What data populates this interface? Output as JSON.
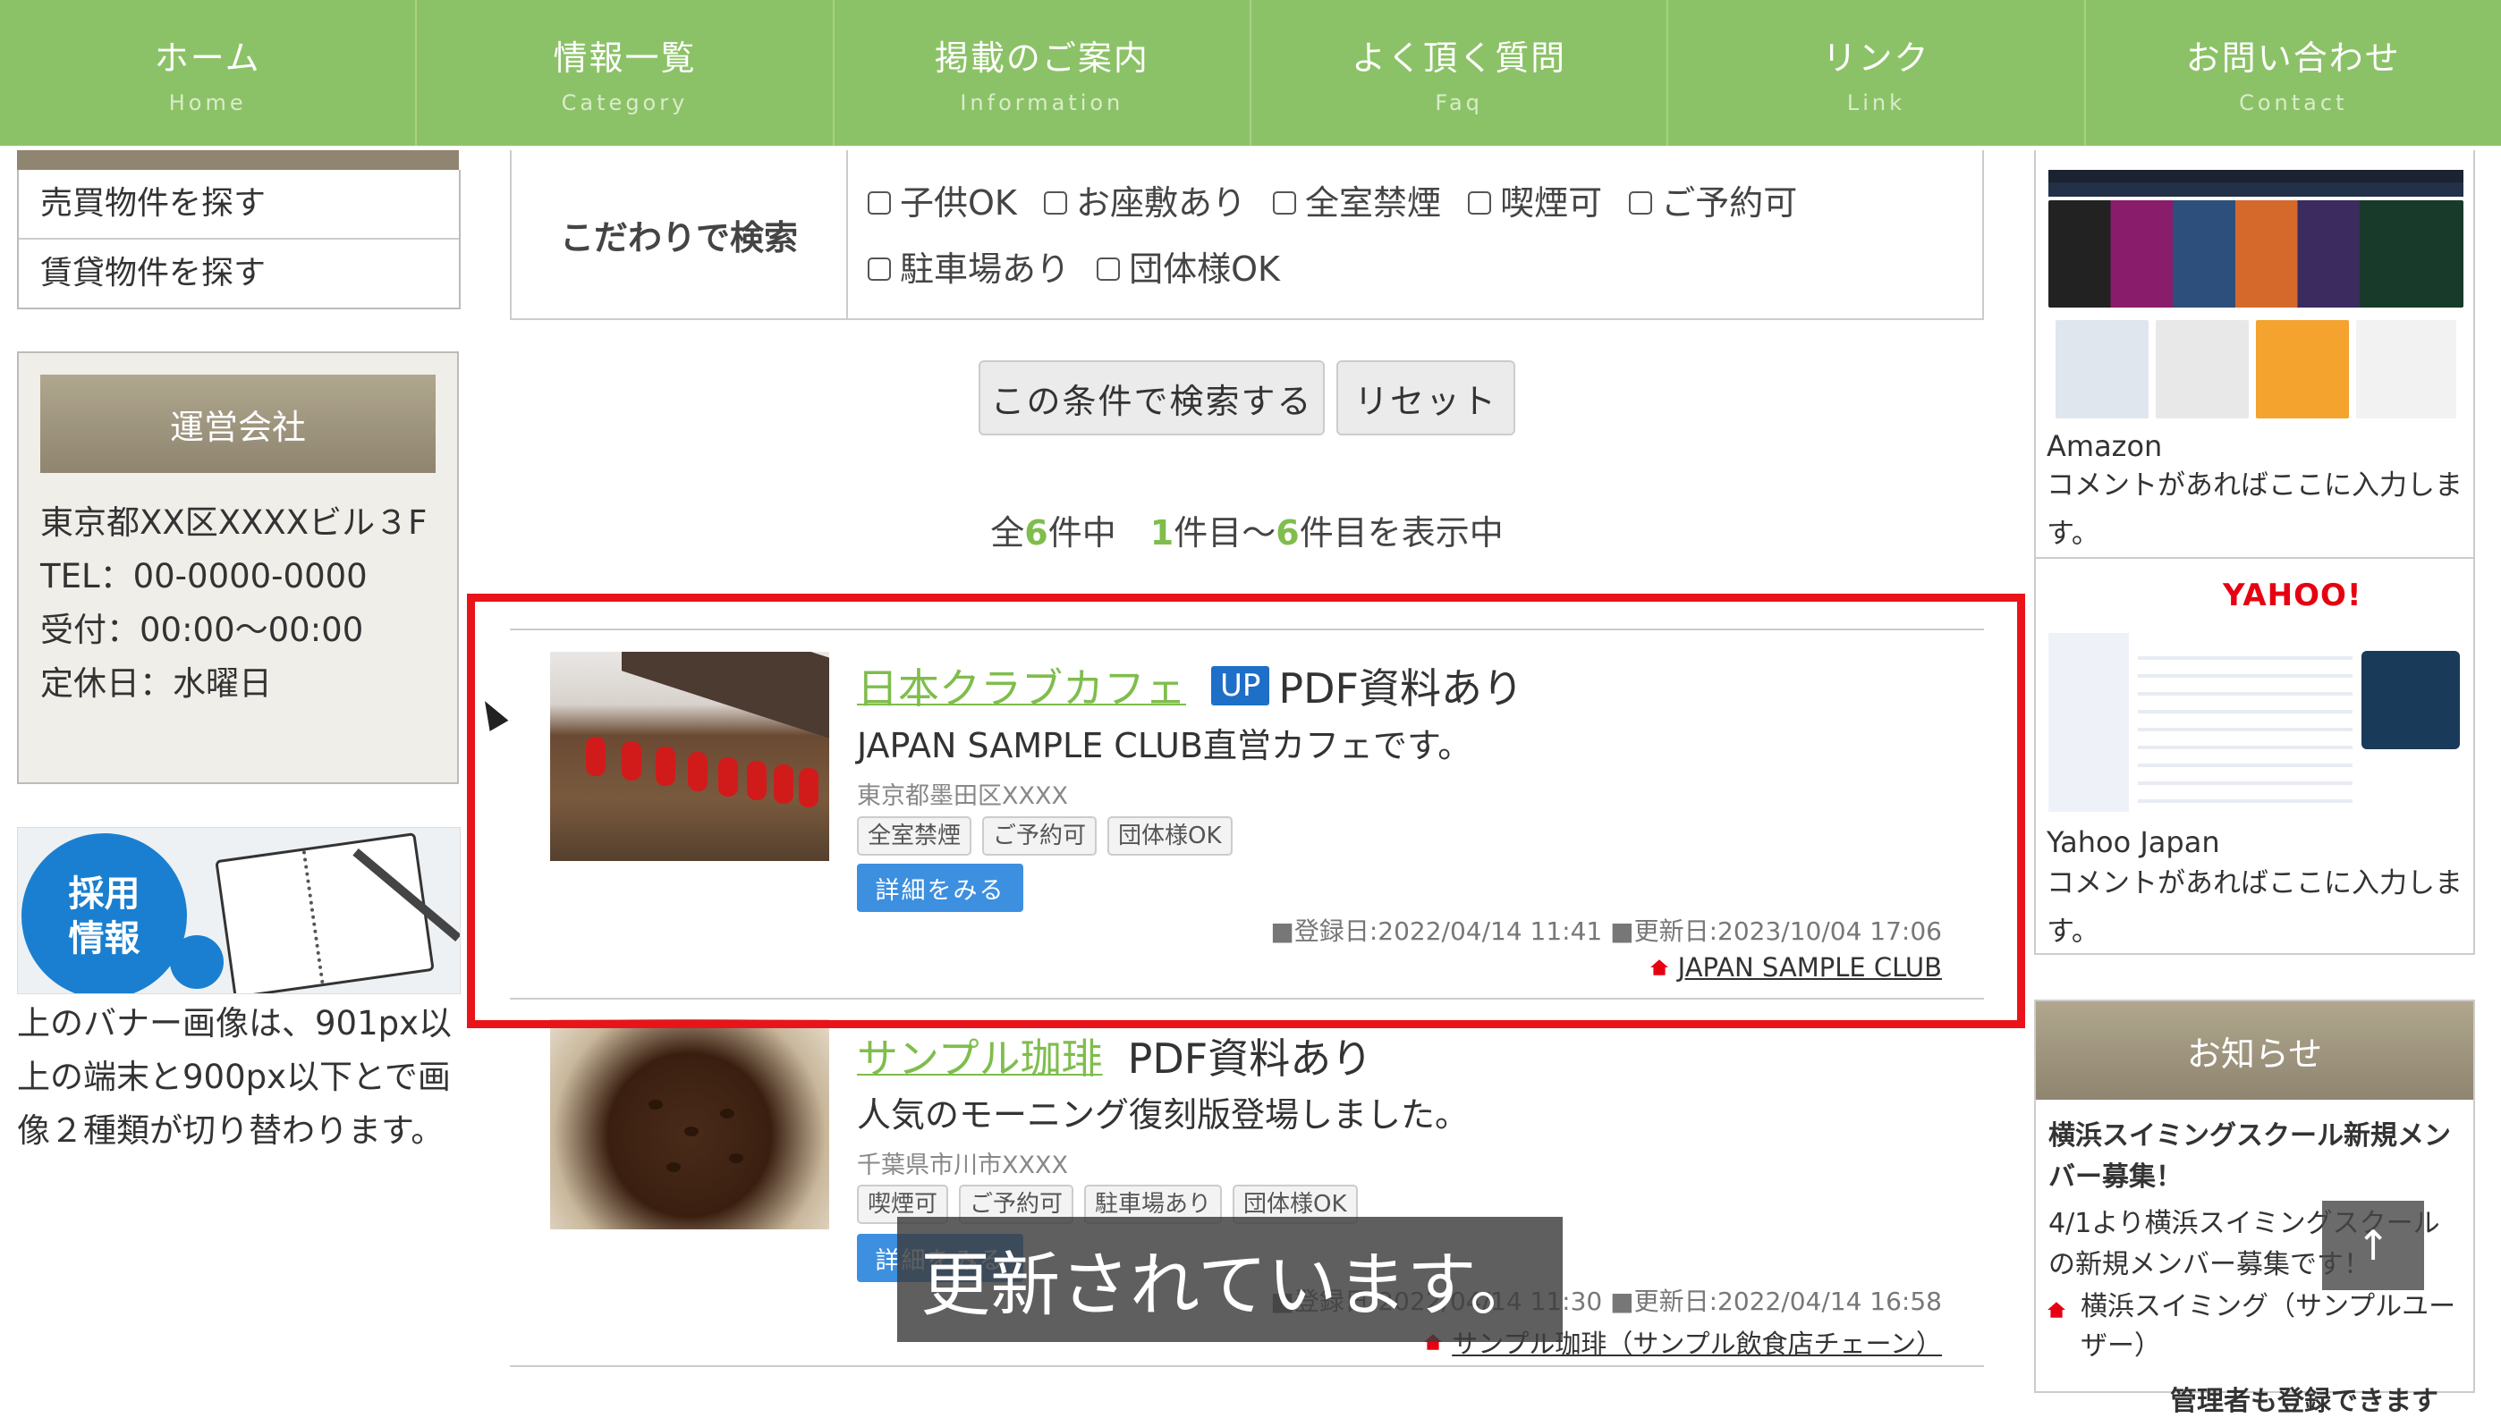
{
  "nav": [
    {
      "jp": "ホーム",
      "en": "Home"
    },
    {
      "jp": "情報一覧",
      "en": "Category"
    },
    {
      "jp": "掲載のご案内",
      "en": "Information"
    },
    {
      "jp": "よく頂く質問",
      "en": "Faq"
    },
    {
      "jp": "リンク",
      "en": "Link"
    },
    {
      "jp": "お問い合わせ",
      "en": "Contact"
    }
  ],
  "left": {
    "links": [
      "売買物件を探す",
      "賃貸物件を探す"
    ],
    "company": {
      "title": "運営会社",
      "address": "東京都XX区XXXXビル３F",
      "tel": "TEL：00-0000-0000",
      "hours": "受付：00:00〜00:00",
      "holiday": "定休日：水曜日"
    },
    "banner_text": "採用\n情報",
    "banner_note": "上のバナー画像は、901px以上の端末と900px以下とで画像２種類が切り替わります。"
  },
  "search": {
    "label": "こだわりで検索",
    "options": [
      "子供OK",
      "お座敷あり",
      "全室禁煙",
      "喫煙可",
      "ご予約可",
      "駐車場あり",
      "団体様OK"
    ],
    "search_button": "この条件で検索する",
    "reset_button": "リセット"
  },
  "count": {
    "pre": "全",
    "total": "6",
    "mid": "件中　",
    "from": "1",
    "mid2": "件目〜",
    "to": "6",
    "post": "件目を表示中"
  },
  "listings": [
    {
      "name": "日本クラブカフェ",
      "badge": "UP",
      "pdf": "PDF資料あり",
      "desc": "JAPAN SAMPLE CLUB直営カフェです。",
      "address": "東京都墨田区XXXX",
      "tags": [
        "全室禁煙",
        "ご予約可",
        "団体様OK"
      ],
      "detail": "詳細をみる",
      "dates": "■登録日:2022/04/14 11:41 ■更新日:2023/10/04 17:06",
      "owner": "JAPAN SAMPLE CLUB"
    },
    {
      "name": "サンプル珈琲",
      "pdf": "PDF資料あり",
      "desc": "人気のモーニング復刻版登場しました。",
      "address": "千葉県市川市XXXX",
      "tags": [
        "喫煙可",
        "ご予約可",
        "駐車場あり",
        "団体様OK"
      ],
      "detail": "詳細をみる",
      "dates": "■登録日:2022/04/14 11:30 ■更新日:2022/04/14 16:58",
      "owner": "サンプル珈琲（サンプル飲食店チェーン）"
    }
  ],
  "caption": "更新されています。",
  "right": {
    "links": [
      {
        "name": "Amazon",
        "comment": "コメントがあればここに入力します。"
      },
      {
        "name": "Yahoo Japan",
        "comment": "コメントがあればここに入力します。"
      }
    ],
    "yahoo_logo": "YAHOO!",
    "news": {
      "title": "お知らせ",
      "item_title": "横浜スイミングスクール新規メンバー募集！",
      "item_body": "4/1より横浜スイミングスクールの新規メンバー募集です！",
      "item_owner": "横浜スイミング（サンプルユーザー）",
      "more": "管理者も登録できます"
    }
  },
  "back_to_top": "↑",
  "colors": {
    "nav_green": "#8cc267",
    "accent_green": "#7fbd4c",
    "highlight_red": "#e8141a",
    "up_blue": "#1d6fc7",
    "detail_blue": "#3d8fe0",
    "heading_khaki": "#8f8570"
  }
}
